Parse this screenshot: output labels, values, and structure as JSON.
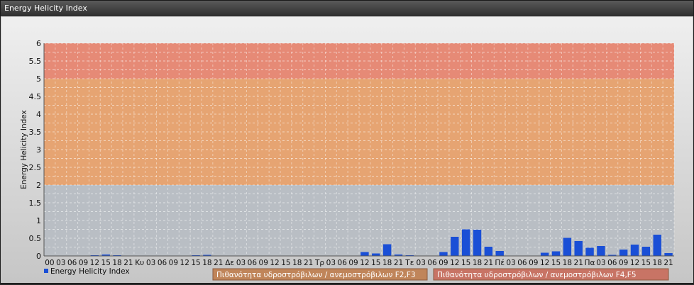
{
  "window": {
    "title": "Energy Helicity Index"
  },
  "chart_data": {
    "type": "bar",
    "title": "",
    "ylabel": "Energy Helicity Index",
    "xlabel": "",
    "ylim": [
      0,
      6
    ],
    "yticks": [
      "0",
      "0.5",
      "1",
      "1.5",
      "2",
      "2.5",
      "3",
      "3.5",
      "4",
      "4.5",
      "5",
      "5.5",
      "6"
    ],
    "categories": [
      "00",
      "03",
      "06",
      "09",
      "12",
      "15",
      "18",
      "21",
      "Κυ",
      "03",
      "06",
      "09",
      "12",
      "15",
      "18",
      "21",
      "Δε",
      "03",
      "06",
      "09",
      "12",
      "15",
      "18",
      "21",
      "Τρ",
      "03",
      "06",
      "09",
      "12",
      "15",
      "18",
      "21",
      "Τε",
      "03",
      "06",
      "09",
      "12",
      "15",
      "18",
      "21",
      "Πέ",
      "03",
      "06",
      "09",
      "12",
      "15",
      "18",
      "21",
      "Πα",
      "03",
      "06",
      "09",
      "12",
      "15",
      "18",
      "21"
    ],
    "series": [
      {
        "name": "Energy Helicity Index",
        "color": "#1a4fd6",
        "values": [
          0.01,
          0.01,
          0.01,
          0.01,
          0.02,
          0.04,
          0.02,
          0.01,
          0.01,
          0.01,
          0.01,
          0.01,
          0.01,
          0.02,
          0.03,
          0.01,
          0.01,
          0.01,
          0.01,
          0.01,
          0.01,
          0.01,
          0.01,
          0.01,
          0.01,
          0.01,
          0.01,
          0.01,
          0.11,
          0.07,
          0.33,
          0.04,
          0.02,
          0.01,
          0.01,
          0.11,
          0.54,
          0.75,
          0.74,
          0.26,
          0.14,
          0.01,
          0.01,
          0.01,
          0.09,
          0.13,
          0.51,
          0.42,
          0.23,
          0.28,
          0.03,
          0.18,
          0.32,
          0.26,
          0.6,
          0.08
        ]
      }
    ],
    "bands": [
      {
        "from": 2,
        "to": 5,
        "color": "#e6a472",
        "label": "Πιθανότητα υδροστρόβιλων / ανεμοστρόβιλων F2,F3"
      },
      {
        "from": 5,
        "to": 6,
        "color": "#e68a76",
        "label": "Πιθανότητα υδροστρόβιλων / ανεμοστρόβιλων F4,F5"
      }
    ],
    "grid": true,
    "legend_position": "bottom-left"
  }
}
